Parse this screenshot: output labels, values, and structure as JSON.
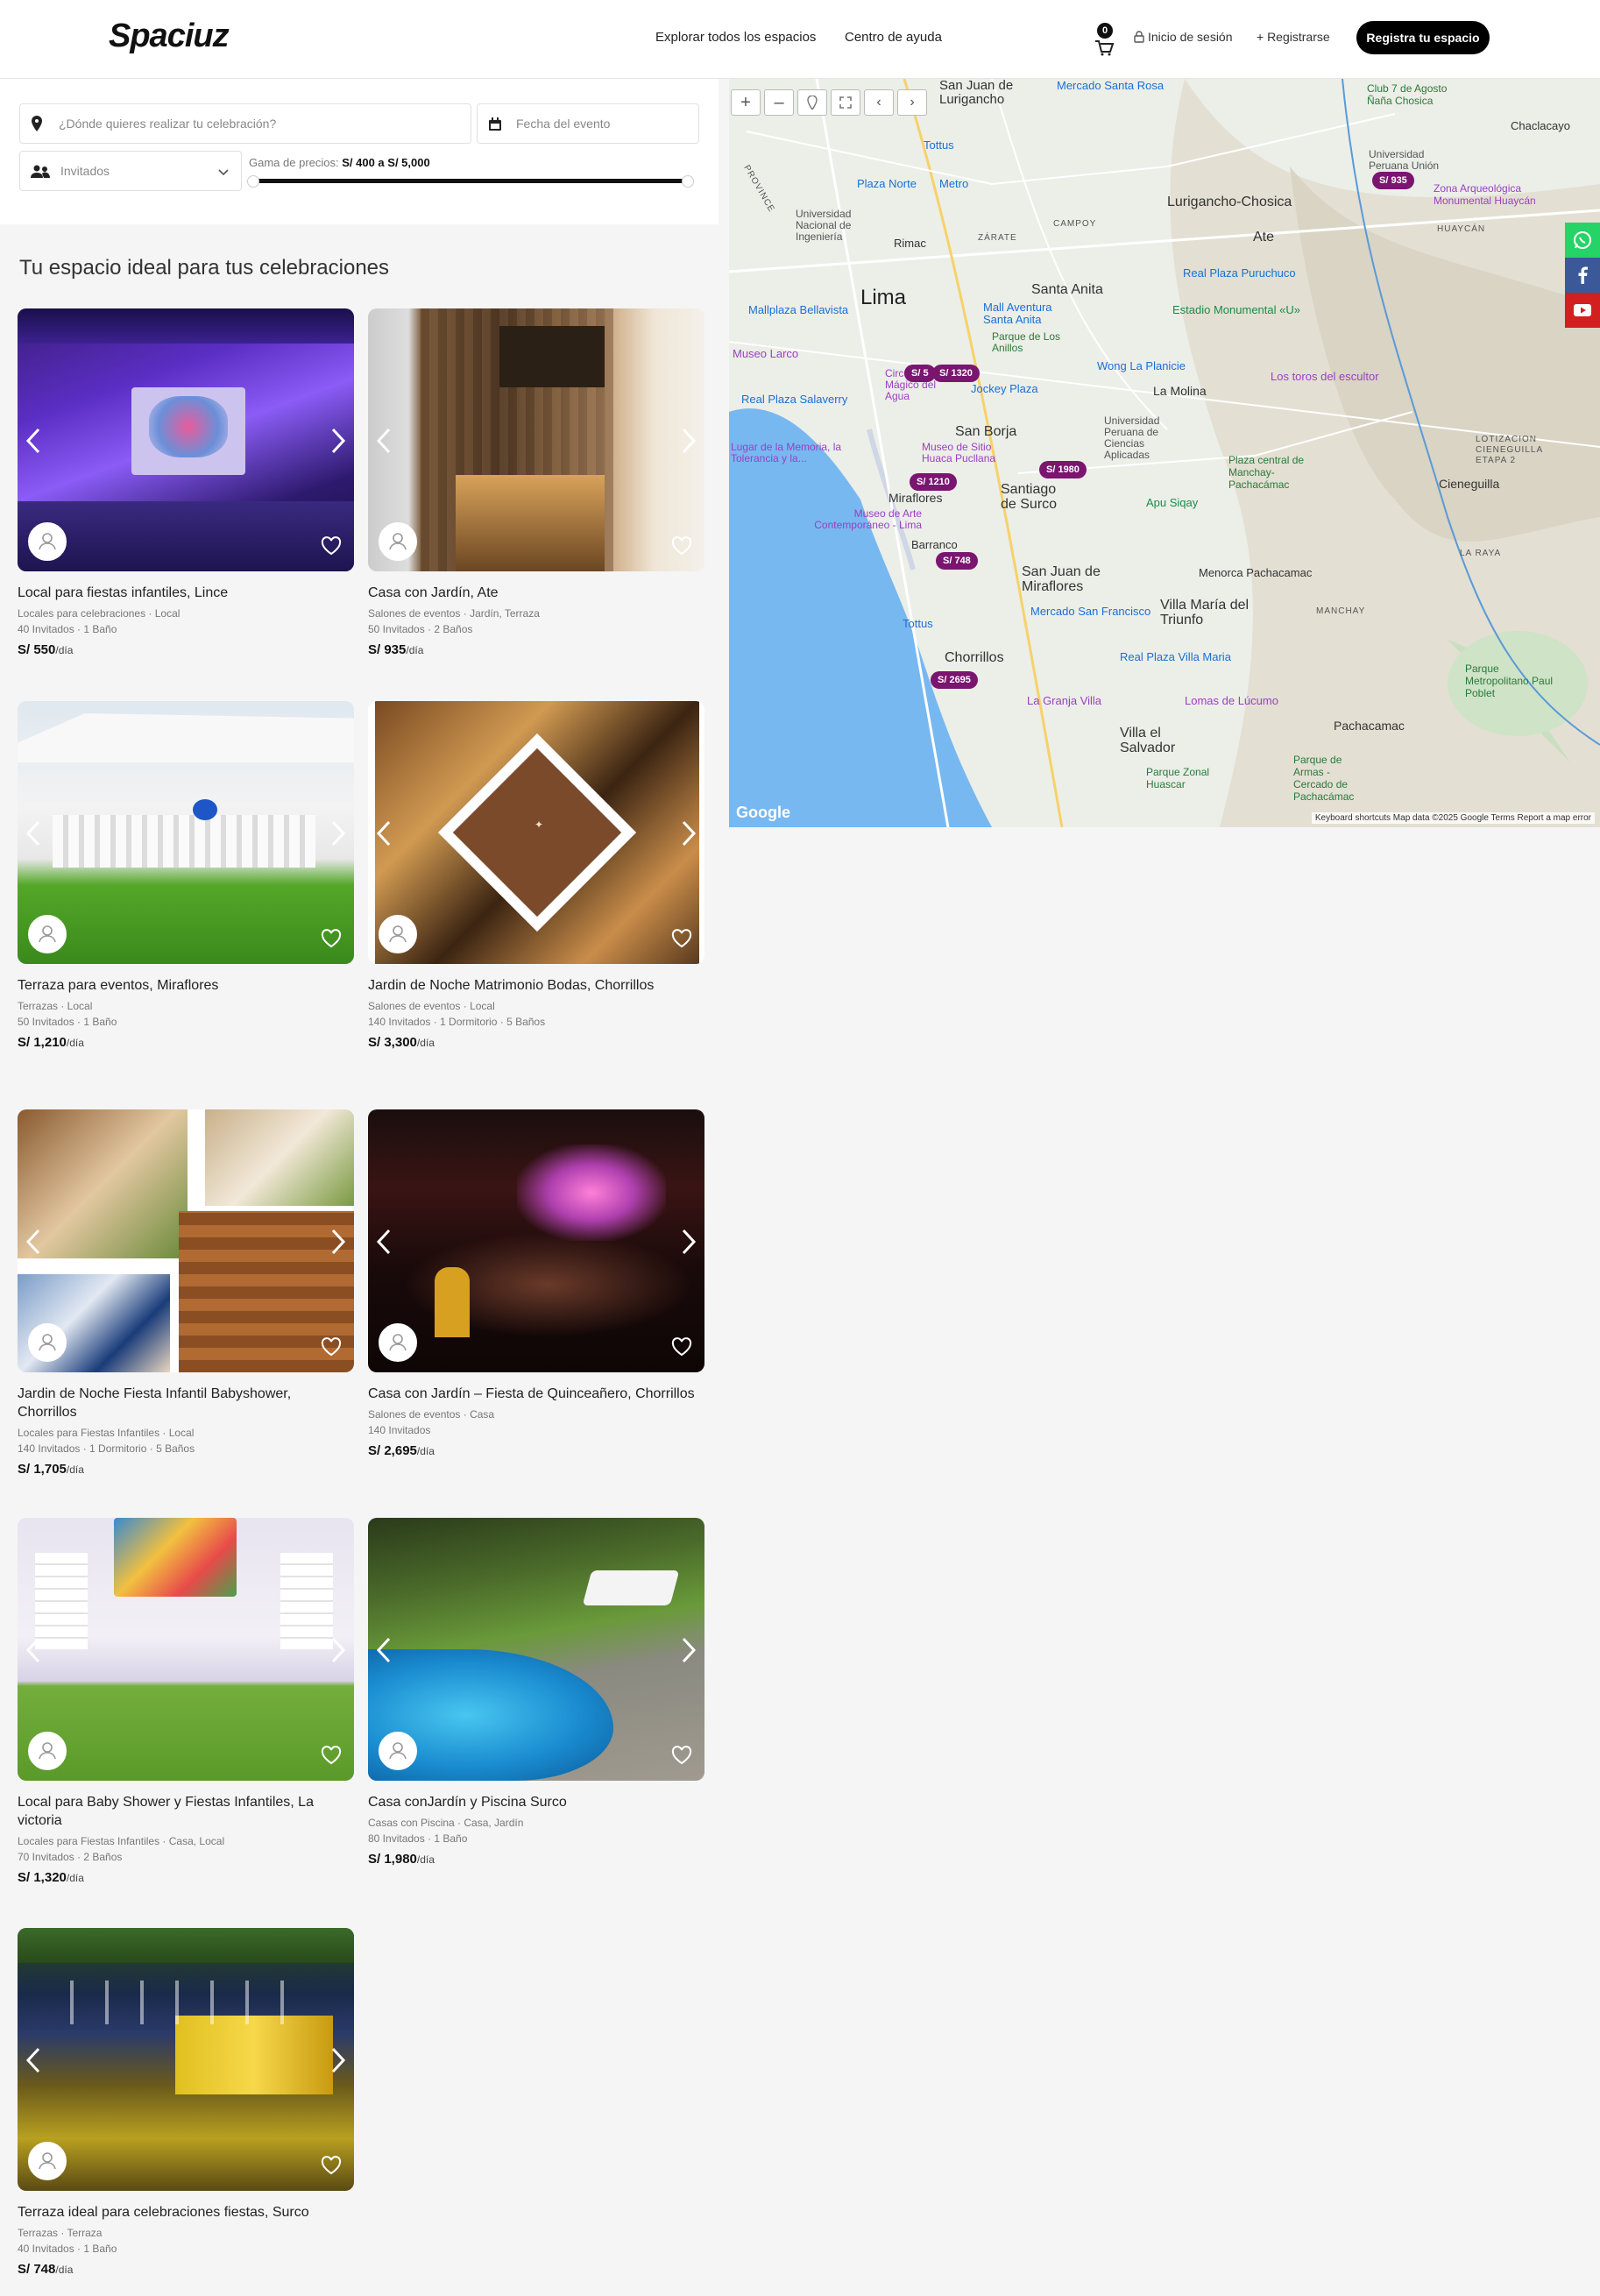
{
  "header": {
    "logo": "Spaciuz",
    "nav_explore": "Explorar todos los espacios",
    "nav_help": "Centro de ayuda",
    "cart_count": "0",
    "login": "Inicio de sesión",
    "register": "+ Registrarse",
    "cta": "Registra tu espacio"
  },
  "filters": {
    "location_placeholder": "¿Dónde quieres realizar tu celebración?",
    "date_placeholder": "Fecha del evento",
    "guests_placeholder": "Invitados",
    "range_label": "Gama de precios:",
    "range_value": "S/ 400 a S/ 5,000"
  },
  "section_title": "Tu espacio ideal para tus celebraciones",
  "listings": [
    {
      "title": "Local para fiestas infantiles, Lince",
      "category": "Locales para celebraciones · Local",
      "details": "40 Invitados · 1 Baño",
      "price": "S/ 550",
      "unit": "/día"
    },
    {
      "title": "Casa con Jardín, Ate",
      "category": "Salones de eventos · Jardín, Terraza",
      "details": "50 Invitados · 2 Baños",
      "price": "S/ 935",
      "unit": "/día"
    },
    {
      "title": "Terraza para eventos, Miraflores",
      "category": "Terrazas · Local",
      "details": "50 Invitados · 1 Baño",
      "price": "S/ 1,210",
      "unit": "/día"
    },
    {
      "title": "Jardin de Noche Matrimonio Bodas, Chorrillos",
      "category": "Salones de eventos · Local",
      "details": "140 Invitados · 1 Dormitorio · 5 Baños",
      "price": "S/ 3,300",
      "unit": "/día"
    },
    {
      "title": "Jardin de Noche Fiesta Infantil Babyshower, Chorrillos",
      "category": "Locales para Fiestas Infantiles · Local",
      "details": "140 Invitados · 1 Dormitorio · 5 Baños",
      "price": "S/ 1,705",
      "unit": "/día"
    },
    {
      "title": "Casa con Jardín – Fiesta de Quinceañero, Chorrillos",
      "category": "Salones de eventos · Casa",
      "details": "140 Invitados",
      "price": "S/ 2,695",
      "unit": "/día"
    },
    {
      "title": "Local para Baby Shower y Fiestas Infantiles, La victoria",
      "category": "Locales para Fiestas Infantiles · Casa, Local",
      "details": "70 Invitados · 2 Baños",
      "price": "S/ 1,320",
      "unit": "/día"
    },
    {
      "title": "Casa conJardín y Piscina Surco",
      "category": "Casas con Piscina · Casa, Jardín",
      "details": "80 Invitados · 1 Baño",
      "price": "S/ 1,980",
      "unit": "/día"
    },
    {
      "title": "Terraza ideal para celebraciones fiestas, Surco",
      "category": "Terrazas · Terraza",
      "details": "40 Invitados · 1 Baño",
      "price": "S/ 748",
      "unit": "/día"
    }
  ],
  "map": {
    "pins": [
      "S/ 935",
      "S/ 5",
      "S/ 1320",
      "S/ 1980",
      "S/ 1210",
      "S/ 748",
      "S/ 2695"
    ],
    "labels": {
      "lima": "Lima",
      "sjl": "San Juan de Lurigancho",
      "santa_anita": "Santa Anita",
      "ate": "Ate",
      "lurigancho": "Lurigancho-Chosica",
      "san_borja": "San Borja",
      "surco": "Santiago de Surco",
      "miraflores": "Miraflores",
      "barranco": "Barranco",
      "sjm": "San Juan de Miraflores",
      "vmt": "Villa María del Triunfo",
      "chorrillos": "Chorrillos",
      "villa_salvador": "Villa el Salvador",
      "cieneguilla": "Cieneguilla",
      "pachacamac": "Pachacamac",
      "la_molina": "La Molina",
      "chaclacayo": "Chaclacayo",
      "rimac": "Rimac",
      "plaza_norte": "Plaza Norte",
      "real_plaza_puruchuco": "Real Plaza Puruchuco",
      "estadio": "Estadio Monumental «U»",
      "mall_aventura": "Mall Aventura Santa Anita",
      "jockey": "Jockey Plaza",
      "larco": "Museo Larco",
      "bellavista": "Mallplaza Bellavista",
      "salaverry": "Real Plaza Salaverry",
      "wong": "Wong La Planicie",
      "toros": "Los toros del escultor",
      "apu": "Apu Siqay",
      "menorca": "Menorca Pachacamac",
      "mercado_sf": "Mercado San Francisco",
      "rp_vmaria": "Real Plaza Villa Maria",
      "granja": "La Granja Villa",
      "lomas": "Lomas de Lúcumo",
      "parque_zonal": "Parque Zonal Huascar",
      "tottus": "Tottus",
      "metro": "Metro",
      "campoy": "CAMPOY",
      "zarate": "ZÁRATE",
      "mercado_rosa": "Mercado Santa Rosa",
      "club7": "Club 7 de Agosto Ñaña Chosica",
      "zona_arq": "Zona Arqueológica Monumental Huaycán",
      "uni": "Universidad Nacional de Ingeniería",
      "pucllana": "Museo de Sitio Huaca Pucllana",
      "mac": "Museo de Arte Contemporáneo - Lima",
      "memoria": "Lugar de la Memoria, la Tolerancia y la...",
      "upc": "Universidad Peruana de Ciencias Aplicadas",
      "manchay_park": "Plaza central de Manchay-Pachacámac",
      "parque_metro": "Parque Metropolitano Paul Poblet",
      "parque_armas": "Parque de Armas - Cercado de Pachacámac",
      "univ_union": "Universidad Peruana Unión",
      "agustino": "Parque de Los Anillos",
      "circuito": "Circuito Mágico del Agua",
      "huaycan": "HUAYCÁN",
      "lotizacion": "LOTIZACION CIENEGUILLA ETAPA 2",
      "la_raya": "LA RAYA",
      "manchay": "MANCHAY",
      "prov": "PROVINCE"
    },
    "footer": "Keyboard shortcuts   Map data ©2025 Google   Terms   Report a map error",
    "brand": "Google"
  },
  "colors": {
    "pin": "#7a1570",
    "whatsapp": "#25d366",
    "facebook": "#3b5998",
    "youtube": "#d21f1f"
  }
}
